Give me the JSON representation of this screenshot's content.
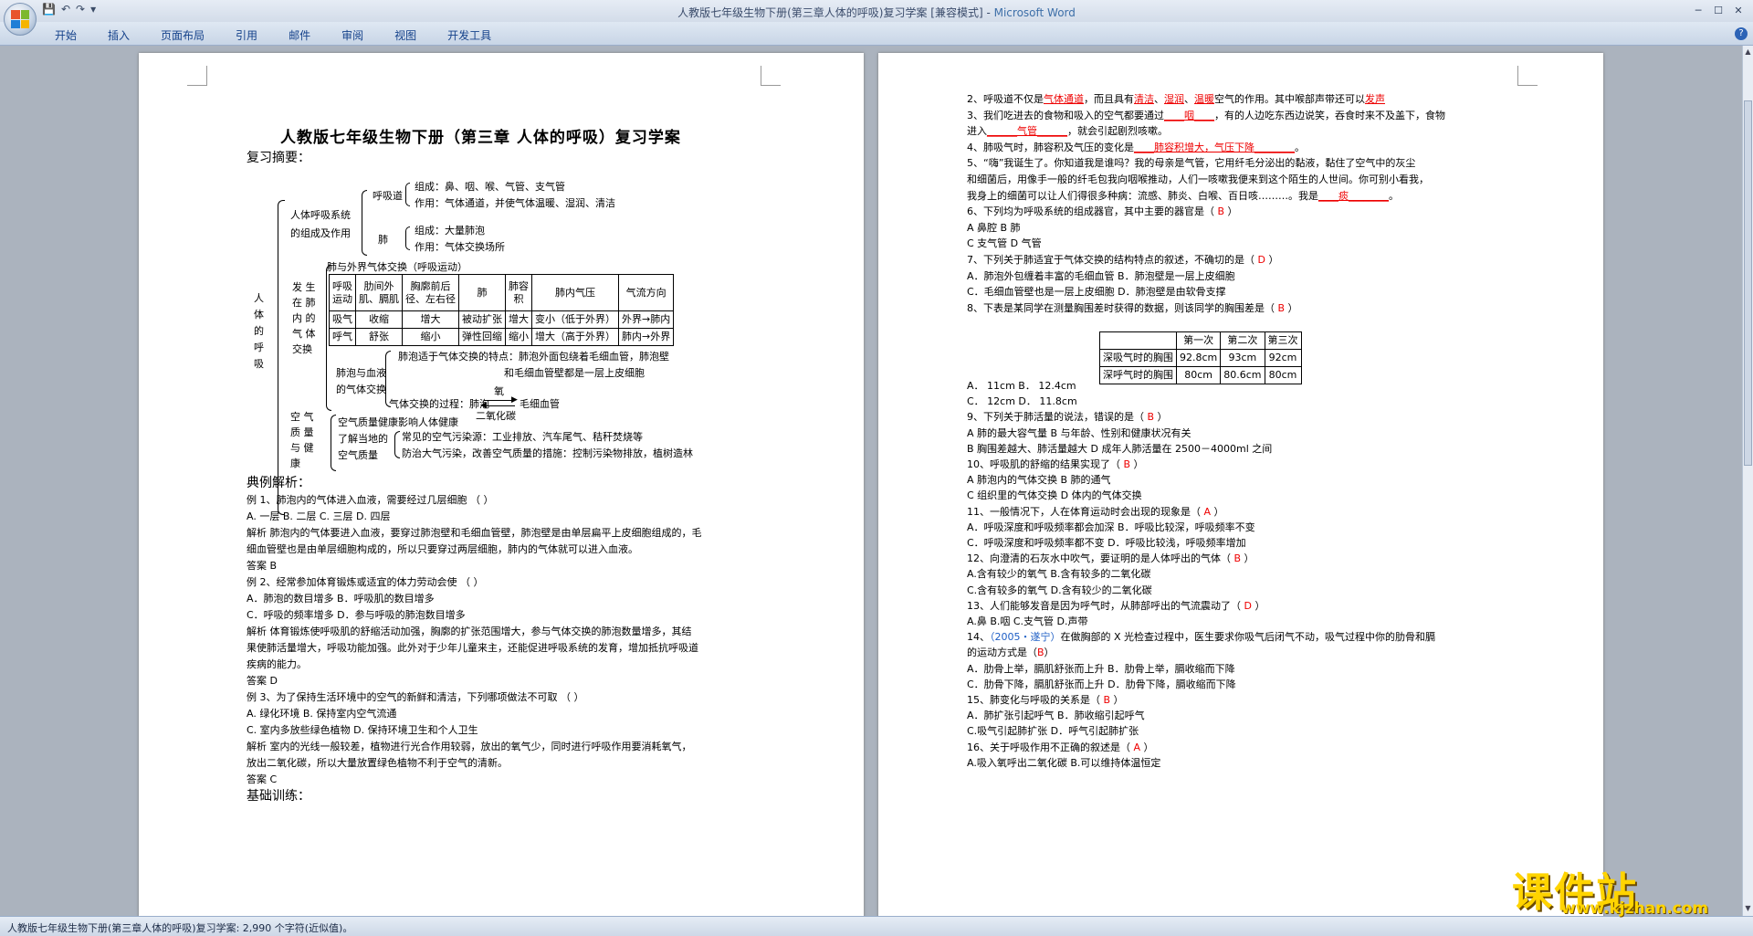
{
  "window": {
    "title": "人教版七年级生物下册(第三章人体的呼吸)复习学案 [兼容模式] - ",
    "app": "Microsoft Word"
  },
  "ribbon": {
    "tabs": [
      "开始",
      "插入",
      "页面布局",
      "引用",
      "邮件",
      "审阅",
      "视图",
      "开发工具"
    ]
  },
  "status": {
    "text": "人教版七年级生物下册(第三章人体的呼吸)复习学案: 2,990 个字符(近似值)。"
  },
  "watermark": {
    "text": "课件站",
    "url": "www.kjzhan.com"
  },
  "page1": {
    "title": "人教版七年级生物下册（第三章   人体的呼吸）复习学案",
    "summary_heading": "复习摘要：",
    "tree": {
      "root": "人\n体\n的\n呼\n吸",
      "sys": "人体呼吸系统\n的组成及作用",
      "tract": "呼吸道",
      "tract_comp": "组成：鼻、咽、喉、气管、支气管",
      "tract_func": "作用：气体通道，并使气体温暖、湿润、清洁",
      "lung": "肺",
      "lung_comp": "组成：大量肺泡",
      "lung_func": "作用：气体交换场所",
      "exch": "发 生\n在 肺\n内 的\n气 体\n交换",
      "tbl_title": "肺与外界气体交换（呼吸运动）",
      "tbl_head": [
        "呼吸\n运动",
        "肋间外\n肌、膈肌",
        "胸廓前后\n径、左右径",
        "肺",
        "肺容\n积",
        "肺内气压",
        "气流方向"
      ],
      "tbl_rows": [
        [
          "吸气",
          "收缩",
          "增大",
          "被动扩张",
          "增大",
          "变小（低于外界）",
          "外界→肺内"
        ],
        [
          "呼气",
          "舒张",
          "缩小",
          "弹性回缩",
          "缩小",
          "增大（高于外界）",
          "肺内→外界"
        ]
      ],
      "blood": "肺泡与血液\n的气体交换",
      "feat1": "肺泡适于气体交换的特点：肺泡外面包绕着毛细血管，肺泡壁",
      "feat2": "和毛细血管壁都是一层上皮细胞",
      "proc": "气体交换的过程：肺泡",
      "o2": "氧",
      "cap": "毛细血管",
      "co2": "二氧化碳",
      "air": "空 气\n质 量\n与 健\n康",
      "air1": "空气质量健康影响人体健康",
      "air2": "了解当地的\n空气质量",
      "src": "常见的空气污染源：工业排放、汽车尾气、秸秆焚烧等",
      "meas": "防治大气污染，改善空气质量的措施：控制污染物排放，植树造林"
    },
    "lines": [
      "典例解析：",
      "例 1、肺泡内的气体进入血液，需要经过几层细胞                （       ）",
      "A. 一层              B. 二层              C. 三层              D. 四层",
      "解析      肺泡内的气体要进入血液，要穿过肺泡壁和毛细血管壁，肺泡壁是由单层扁平上皮细胞组成的，毛",
      "细血管壁也是由单层细胞构成的，所以只要穿过两层细胞，肺内的气体就可以进入血液。",
      "答案      B",
      "例 2、经常参加体育锻炼或适宜的体力劳动会使                       （       ）",
      "A．肺泡的数目增多      B．呼吸肌的数目增多",
      "C．呼吸的频率增多      D．参与呼吸的肺泡数目增多",
      "解析      体育锻炼使呼吸肌的舒缩活动加强，胸廓的扩张范围增大，参与气体交换的肺泡数量增多，其结",
      "果使肺活量增大，呼吸功能加强。此外对于少年儿童来主，还能促进呼吸系统的发育，增加抵抗呼吸道",
      "疾病的能力。",
      "答案      D",
      "例 3、为了保持生活环境中的空气的新鲜和清洁，下列哪项做法不可取              （       ）",
      "A. 绿化环境                                      B. 保持室内空气流通",
      "C. 室内多放些绿色植物                            D. 保持环境卫生和个人卫生",
      "解析      室内的光线一般较差，植物进行光合作用较弱，放出的氧气少，同时进行呼吸作用要消耗氧气，",
      "          放出二氧化碳，所以大量放置绿色植物不利于空气的清新。",
      "答案      C",
      "基础训练："
    ]
  },
  "page2": {
    "lines": [
      {
        "parts": [
          [
            "2、呼吸道不仅是",
            ""
          ],
          [
            "气体通道",
            "red u"
          ],
          [
            "，而且具有",
            ""
          ],
          [
            "清洁",
            "red u"
          ],
          [
            "、",
            ""
          ],
          [
            "湿润",
            "red u"
          ],
          [
            "、",
            ""
          ],
          [
            "温暖",
            "red u"
          ],
          [
            "空气的作用。其中喉部声带还可以",
            ""
          ],
          [
            "发声",
            "red u"
          ]
        ]
      },
      {
        "parts": [
          [
            "3、我们吃进去的食物和吸入的空气都要通过",
            ""
          ],
          [
            "____咽____",
            "red u"
          ],
          [
            "，有的人边吃东西边说笑，吞食时来不及盖下，食物",
            ""
          ]
        ]
      },
      {
        "parts": [
          [
            "进入",
            ""
          ],
          [
            "______气管______",
            "red u"
          ],
          [
            "，就会引起剧烈咳嗽。",
            ""
          ]
        ]
      },
      {
        "parts": [
          [
            "4、肺吸气时，肺容积及气压的变化是",
            ""
          ],
          [
            "____肺容积增大，气压下降________",
            "red u"
          ],
          [
            "。",
            ""
          ]
        ]
      },
      {
        "parts": [
          [
            "5、“嗨”我诞生了。你知道我是谁吗？我的母亲是气管，它用纤毛分泌出的黏液，黏住了空气中的灰尘",
            ""
          ]
        ]
      },
      {
        "parts": [
          [
            "和细菌后，用像手一般的纤毛包我向咽喉推动，人们一咳嗽我便来到这个陌生的人世间。你可别小看我，",
            ""
          ]
        ]
      },
      {
        "parts": [
          [
            "我身上的细菌可以让人们得很多种病：流感、肺炎、白喉、百日咳………。我是",
            ""
          ],
          [
            "____痰________",
            "red u"
          ],
          [
            "。",
            ""
          ]
        ]
      },
      {
        "parts": [
          [
            "6、下列均为呼吸系统的组成器官，其中主要的器官是（    ",
            ""
          ],
          [
            "B",
            "red"
          ],
          [
            "    ）",
            ""
          ]
        ]
      },
      {
        "parts": [
          [
            "A 鼻腔                                    B 肺",
            ""
          ]
        ]
      },
      {
        "parts": [
          [
            "C 支气管                                 D 气管",
            ""
          ]
        ]
      },
      {
        "parts": [
          [
            "7、下列关于肺适宜于气体交换的结构特点的叙述，不确切的是（    ",
            ""
          ],
          [
            "D",
            "red"
          ],
          [
            "    ）",
            ""
          ]
        ]
      },
      {
        "parts": [
          [
            "A．肺泡外包缠着丰富的毛细血管               B．肺泡壁是一层上皮细胞",
            ""
          ]
        ]
      },
      {
        "parts": [
          [
            "C．毛细血管壁也是一层上皮细胞               D．肺泡壁是由软骨支撑",
            ""
          ]
        ]
      },
      {
        "parts": [
          [
            "8、下表是某同学在测量胸围差时获得的数据，则该同学的胸围差是（    ",
            ""
          ],
          [
            "B",
            "red"
          ],
          [
            "    ）",
            ""
          ]
        ]
      }
    ],
    "table": {
      "head": [
        "",
        "第一次",
        "第二次",
        "第三次"
      ],
      "rows": [
        [
          "深吸气时的胸围",
          "92.8cm",
          "93cm",
          "92cm"
        ],
        [
          "深呼气时的胸围",
          "80cm",
          "80.6cm",
          "80cm"
        ]
      ]
    },
    "lines2": [
      {
        "parts": [
          [
            "A．   11cm                    B．   12.4cm",
            ""
          ]
        ]
      },
      {
        "parts": [
          [
            "C．   12cm                    D．   11.8cm",
            ""
          ]
        ]
      },
      {
        "parts": [
          [
            "9、下列关于肺活量的说法，错误的是（    ",
            ""
          ],
          [
            "B",
            "red"
          ],
          [
            "    ）",
            ""
          ]
        ]
      },
      {
        "parts": [
          [
            "A 肺的最大容气量                                            B 与年龄、性别和健康状况有关",
            ""
          ]
        ]
      },
      {
        "parts": [
          [
            "B 胸围差越大、肺活量越大                                    D 成年人肺活量在 2500－4000ml 之间",
            ""
          ]
        ]
      },
      {
        "parts": [
          [
            "10、呼吸肌的舒缩的结果实现了（    ",
            ""
          ],
          [
            "B",
            "red"
          ],
          [
            "    ）",
            ""
          ]
        ]
      },
      {
        "parts": [
          [
            "A 肺泡内的气体交换                                          B 肺的通气",
            ""
          ]
        ]
      },
      {
        "parts": [
          [
            "C 组织里的气体交换                                          D 体内的气体交换",
            ""
          ]
        ]
      },
      {
        "parts": [
          [
            "11、一般情况下，人在体育运动时会出现的现象是（    ",
            ""
          ],
          [
            "A",
            "red"
          ],
          [
            "    ）",
            ""
          ]
        ]
      },
      {
        "parts": [
          [
            "A．呼吸深度和呼吸频率都会加深                     B．呼吸比较深，呼吸频率不变",
            ""
          ]
        ]
      },
      {
        "parts": [
          [
            "C．呼吸深度和呼吸频率都不变                       D．呼吸比较浅，呼吸频率增加",
            ""
          ]
        ]
      },
      {
        "parts": [
          [
            "12、向澄清的石灰水中吹气，要证明的是人体呼出的气体（    ",
            ""
          ],
          [
            "B",
            "red"
          ],
          [
            "    ）",
            ""
          ]
        ]
      },
      {
        "parts": [
          [
            "A.含有较少的氧气                                            B.含有较多的二氧化碳",
            ""
          ]
        ]
      },
      {
        "parts": [
          [
            "C.含有较多的氧气                                            D.含有较少的二氧化碳",
            ""
          ]
        ]
      },
      {
        "parts": [
          [
            "13、人们能够发音是因为呼气时，从肺部呼出的气流震动了（    ",
            ""
          ],
          [
            "D",
            "red"
          ],
          [
            "    ）",
            ""
          ]
        ]
      },
      {
        "parts": [
          [
            "A.鼻                  B.咽                  C.支气管              D.声带",
            ""
          ]
        ]
      },
      {
        "parts": [
          [
            "14、",
            ""
          ],
          [
            "（2005・遂宁）",
            "blue"
          ],
          [
            "在做胸部的  X  光检查过程中，医生要求你吸气后闭气不动，吸气过程中你的肋骨和膈",
            ""
          ]
        ]
      },
      {
        "parts": [
          [
            "的运动方式是（",
            ""
          ],
          [
            "B",
            "red"
          ],
          [
            "）",
            ""
          ]
        ]
      },
      {
        "parts": [
          [
            "A．肋骨上举，膈肌舒张而上升                         B．肋骨上举，膈收缩而下降",
            ""
          ]
        ]
      },
      {
        "parts": [
          [
            "C．肋骨下降，膈肌舒张而上升                         D．肋骨下降，膈收缩而下降",
            ""
          ]
        ]
      },
      {
        "parts": [
          [
            "15、肺变化与呼吸的关系是（    ",
            ""
          ],
          [
            "B",
            "red"
          ],
          [
            "    ）",
            ""
          ]
        ]
      },
      {
        "parts": [
          [
            "A．肺扩张引起呼气                                   B．肺收缩引起呼气",
            ""
          ]
        ]
      },
      {
        "parts": [
          [
            "C.吸气引起肺扩张                                    D．呼气引起肺扩张",
            ""
          ]
        ]
      },
      {
        "parts": [
          [
            "16、关于呼吸作用不正确的叙述是（    ",
            ""
          ],
          [
            "A",
            "red"
          ],
          [
            "    ）",
            ""
          ]
        ]
      },
      {
        "parts": [
          [
            "A.吸入氧呼出二氧化碳                                B.可以维持体温恒定",
            ""
          ]
        ]
      }
    ]
  }
}
